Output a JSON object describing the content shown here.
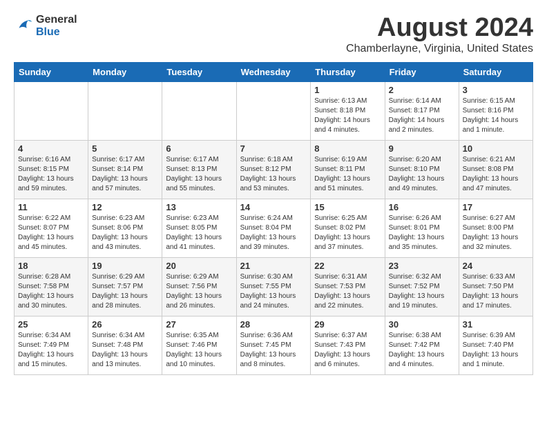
{
  "header": {
    "logo_line1": "General",
    "logo_line2": "Blue",
    "month_year": "August 2024",
    "location": "Chamberlayne, Virginia, United States"
  },
  "weekdays": [
    "Sunday",
    "Monday",
    "Tuesday",
    "Wednesday",
    "Thursday",
    "Friday",
    "Saturday"
  ],
  "weeks": [
    [
      {
        "day": "",
        "info": ""
      },
      {
        "day": "",
        "info": ""
      },
      {
        "day": "",
        "info": ""
      },
      {
        "day": "",
        "info": ""
      },
      {
        "day": "1",
        "info": "Sunrise: 6:13 AM\nSunset: 8:18 PM\nDaylight: 14 hours\nand 4 minutes."
      },
      {
        "day": "2",
        "info": "Sunrise: 6:14 AM\nSunset: 8:17 PM\nDaylight: 14 hours\nand 2 minutes."
      },
      {
        "day": "3",
        "info": "Sunrise: 6:15 AM\nSunset: 8:16 PM\nDaylight: 14 hours\nand 1 minute."
      }
    ],
    [
      {
        "day": "4",
        "info": "Sunrise: 6:16 AM\nSunset: 8:15 PM\nDaylight: 13 hours\nand 59 minutes."
      },
      {
        "day": "5",
        "info": "Sunrise: 6:17 AM\nSunset: 8:14 PM\nDaylight: 13 hours\nand 57 minutes."
      },
      {
        "day": "6",
        "info": "Sunrise: 6:17 AM\nSunset: 8:13 PM\nDaylight: 13 hours\nand 55 minutes."
      },
      {
        "day": "7",
        "info": "Sunrise: 6:18 AM\nSunset: 8:12 PM\nDaylight: 13 hours\nand 53 minutes."
      },
      {
        "day": "8",
        "info": "Sunrise: 6:19 AM\nSunset: 8:11 PM\nDaylight: 13 hours\nand 51 minutes."
      },
      {
        "day": "9",
        "info": "Sunrise: 6:20 AM\nSunset: 8:10 PM\nDaylight: 13 hours\nand 49 minutes."
      },
      {
        "day": "10",
        "info": "Sunrise: 6:21 AM\nSunset: 8:08 PM\nDaylight: 13 hours\nand 47 minutes."
      }
    ],
    [
      {
        "day": "11",
        "info": "Sunrise: 6:22 AM\nSunset: 8:07 PM\nDaylight: 13 hours\nand 45 minutes."
      },
      {
        "day": "12",
        "info": "Sunrise: 6:23 AM\nSunset: 8:06 PM\nDaylight: 13 hours\nand 43 minutes."
      },
      {
        "day": "13",
        "info": "Sunrise: 6:23 AM\nSunset: 8:05 PM\nDaylight: 13 hours\nand 41 minutes."
      },
      {
        "day": "14",
        "info": "Sunrise: 6:24 AM\nSunset: 8:04 PM\nDaylight: 13 hours\nand 39 minutes."
      },
      {
        "day": "15",
        "info": "Sunrise: 6:25 AM\nSunset: 8:02 PM\nDaylight: 13 hours\nand 37 minutes."
      },
      {
        "day": "16",
        "info": "Sunrise: 6:26 AM\nSunset: 8:01 PM\nDaylight: 13 hours\nand 35 minutes."
      },
      {
        "day": "17",
        "info": "Sunrise: 6:27 AM\nSunset: 8:00 PM\nDaylight: 13 hours\nand 32 minutes."
      }
    ],
    [
      {
        "day": "18",
        "info": "Sunrise: 6:28 AM\nSunset: 7:58 PM\nDaylight: 13 hours\nand 30 minutes."
      },
      {
        "day": "19",
        "info": "Sunrise: 6:29 AM\nSunset: 7:57 PM\nDaylight: 13 hours\nand 28 minutes."
      },
      {
        "day": "20",
        "info": "Sunrise: 6:29 AM\nSunset: 7:56 PM\nDaylight: 13 hours\nand 26 minutes."
      },
      {
        "day": "21",
        "info": "Sunrise: 6:30 AM\nSunset: 7:55 PM\nDaylight: 13 hours\nand 24 minutes."
      },
      {
        "day": "22",
        "info": "Sunrise: 6:31 AM\nSunset: 7:53 PM\nDaylight: 13 hours\nand 22 minutes."
      },
      {
        "day": "23",
        "info": "Sunrise: 6:32 AM\nSunset: 7:52 PM\nDaylight: 13 hours\nand 19 minutes."
      },
      {
        "day": "24",
        "info": "Sunrise: 6:33 AM\nSunset: 7:50 PM\nDaylight: 13 hours\nand 17 minutes."
      }
    ],
    [
      {
        "day": "25",
        "info": "Sunrise: 6:34 AM\nSunset: 7:49 PM\nDaylight: 13 hours\nand 15 minutes."
      },
      {
        "day": "26",
        "info": "Sunrise: 6:34 AM\nSunset: 7:48 PM\nDaylight: 13 hours\nand 13 minutes."
      },
      {
        "day": "27",
        "info": "Sunrise: 6:35 AM\nSunset: 7:46 PM\nDaylight: 13 hours\nand 10 minutes."
      },
      {
        "day": "28",
        "info": "Sunrise: 6:36 AM\nSunset: 7:45 PM\nDaylight: 13 hours\nand 8 minutes."
      },
      {
        "day": "29",
        "info": "Sunrise: 6:37 AM\nSunset: 7:43 PM\nDaylight: 13 hours\nand 6 minutes."
      },
      {
        "day": "30",
        "info": "Sunrise: 6:38 AM\nSunset: 7:42 PM\nDaylight: 13 hours\nand 4 minutes."
      },
      {
        "day": "31",
        "info": "Sunrise: 6:39 AM\nSunset: 7:40 PM\nDaylight: 13 hours\nand 1 minute."
      }
    ]
  ]
}
